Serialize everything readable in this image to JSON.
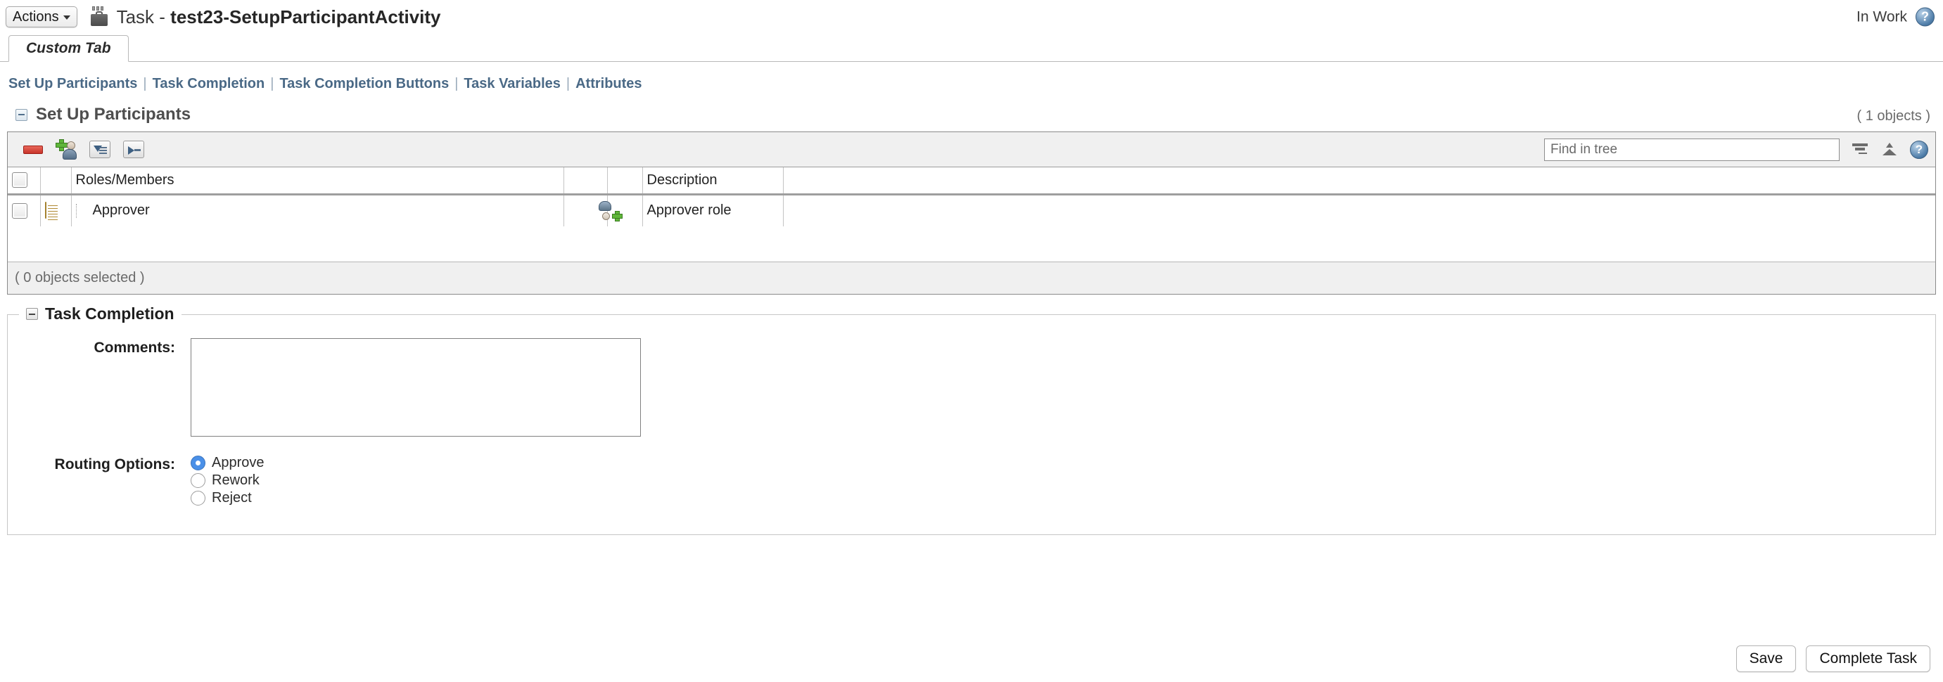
{
  "header": {
    "actions_label": "Actions",
    "title_prefix": "Task - ",
    "title_name": "test23-SetupParticipantActivity",
    "status": "In Work",
    "help_glyph": "?"
  },
  "tabs": [
    {
      "label": "Custom Tab",
      "active": true
    }
  ],
  "navlinks": [
    {
      "label": "Set Up Participants"
    },
    {
      "label": "Task Completion"
    },
    {
      "label": "Task Completion Buttons"
    },
    {
      "label": "Task Variables"
    },
    {
      "label": "Attributes"
    }
  ],
  "participants_section": {
    "title": "Set Up Participants",
    "objects_count": "( 1 objects )",
    "toolbar": {
      "remove_label": "Remove",
      "add_participant_label": "Add Participant",
      "filter_label": "Filter",
      "expand_label": "Expand",
      "search_placeholder": "Find in tree",
      "search_value": "",
      "help_glyph": "?"
    },
    "columns": [
      "",
      "",
      "Roles/Members",
      "",
      "",
      "Description",
      ""
    ],
    "rows": [
      {
        "name": "Approver",
        "description": "Approver role"
      }
    ],
    "footer": "( 0 objects selected )"
  },
  "task_completion": {
    "legend": "Task Completion",
    "comments_label": "Comments:",
    "comments_value": "",
    "routing_label": "Routing Options:",
    "routing_options": [
      {
        "label": "Approve",
        "selected": true
      },
      {
        "label": "Rework",
        "selected": false
      },
      {
        "label": "Reject",
        "selected": false
      }
    ]
  },
  "footer_buttons": {
    "save": "Save",
    "complete_task": "Complete Task"
  }
}
